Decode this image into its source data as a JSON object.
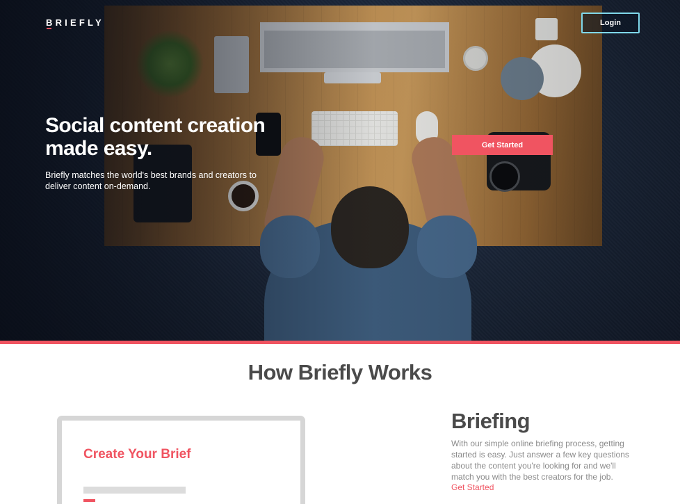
{
  "brand": {
    "logo_text": "BRIEFLY",
    "accent_color": "#f05461",
    "login_border_color": "#7fd8ea"
  },
  "nav": {
    "login_label": "Login"
  },
  "hero": {
    "title": "Social content creation made easy.",
    "subtitle": "Briefly matches the world's best brands and creators to deliver content on-demand.",
    "cta_label": "Get Started"
  },
  "how": {
    "title": "How Briefly Works",
    "mockup": {
      "title": "Create Your Brief"
    },
    "feature": {
      "title": "Briefing",
      "description": "With our simple online briefing process, getting started is easy. Just answer a few key questions about the content you're looking for and we'll match you with the best creators for the job.",
      "link_label": "Get Started"
    }
  }
}
